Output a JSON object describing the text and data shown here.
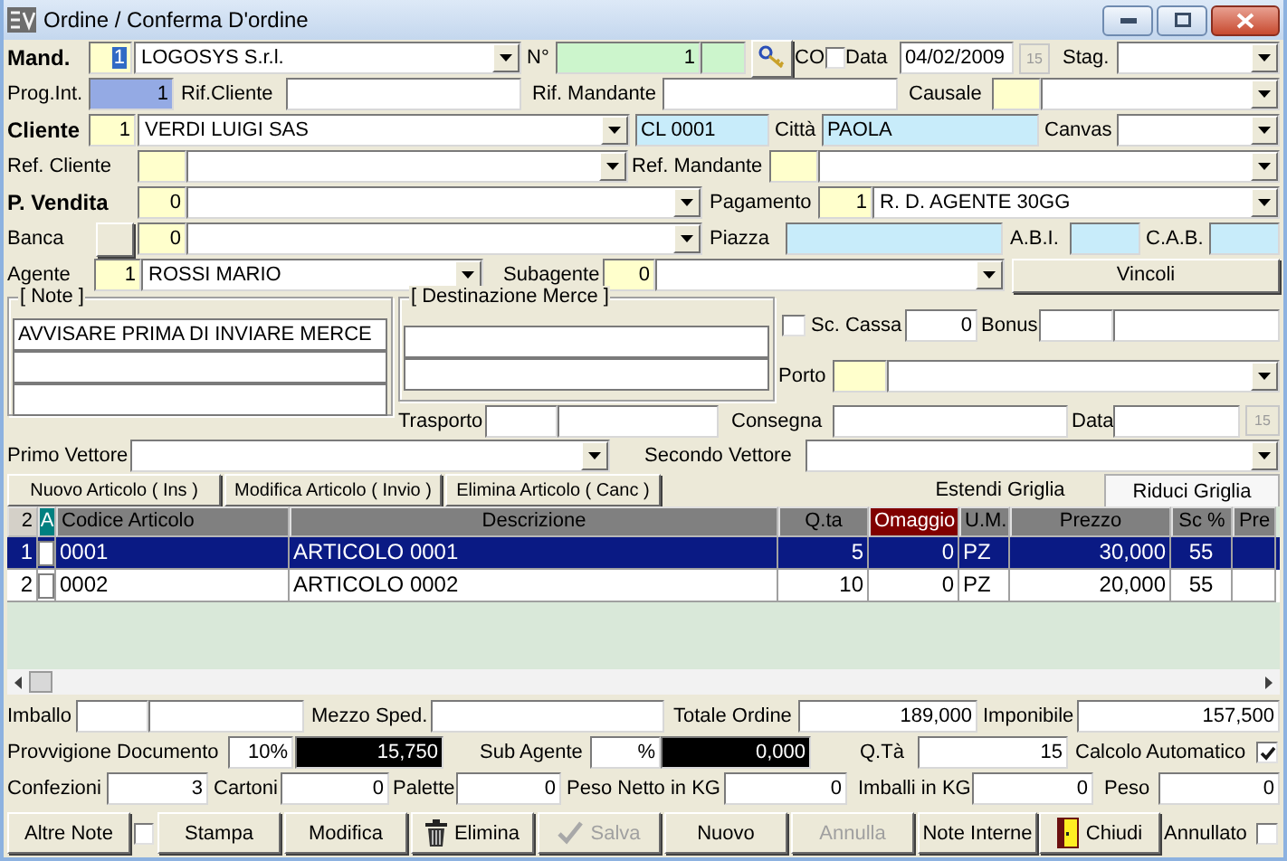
{
  "window": {
    "title": "Ordine / Conferma D'ordine"
  },
  "header_rows": [
    {
      "items": [
        {
          "kind": "heading",
          "text": "Mand."
        },
        {
          "kind": "number_selected",
          "value": "1",
          "color": "#ffffcc"
        },
        {
          "kind": "combo",
          "value": "LOGOSYS S.r.l."
        },
        {
          "kind": "label",
          "text": "N°"
        },
        {
          "kind": "number",
          "value": "1",
          "color": "#ccf5cc"
        },
        {
          "kind": "field",
          "color": "#ccf5cc"
        },
        {
          "kind": "icon_button"
        },
        {
          "kind": "label",
          "text": "CO"
        },
        {
          "kind": "check",
          "checked": false
        },
        {
          "kind": "label",
          "text": "Data"
        },
        {
          "kind": "field",
          "value": "04/02/2009"
        },
        {
          "kind": "calendar",
          "text": "15"
        },
        {
          "kind": "label",
          "text": "Stag."
        },
        {
          "kind": "combo"
        }
      ]
    },
    {
      "items": [
        {
          "kind": "label",
          "text": "Prog.Int."
        },
        {
          "kind": "number",
          "value": "1",
          "color": "#94aae4"
        },
        {
          "kind": "label",
          "text": "Rif.Cliente"
        },
        {
          "kind": "field"
        },
        {
          "kind": "label",
          "text": "Rif. Mandante"
        },
        {
          "kind": "field"
        },
        {
          "kind": "label",
          "text": "Causale"
        },
        {
          "kind": "field",
          "color": "#ffffcc"
        },
        {
          "kind": "combo"
        }
      ]
    },
    {
      "items": [
        {
          "kind": "heading",
          "text": "Cliente"
        },
        {
          "kind": "number",
          "value": "1",
          "color": "#ffffcc"
        },
        {
          "kind": "combo",
          "value": "VERDI LUIGI SAS"
        },
        {
          "kind": "field",
          "value": "CL 0001",
          "color": "#c8ecfa"
        },
        {
          "kind": "label",
          "text": "Città"
        },
        {
          "kind": "field",
          "value": "PAOLA",
          "color": "#c8ecfa"
        },
        {
          "kind": "label",
          "text": "Canvas"
        },
        {
          "kind": "combo"
        }
      ]
    },
    {
      "items": [
        {
          "kind": "label",
          "text": "Ref. Cliente"
        },
        {
          "kind": "field",
          "color": "#ffffcc"
        },
        {
          "kind": "combo"
        },
        {
          "kind": "label",
          "text": "Ref. Mandante"
        },
        {
          "kind": "field",
          "color": "#ffffcc"
        },
        {
          "kind": "combo"
        }
      ]
    },
    {
      "items": [
        {
          "kind": "heading",
          "text": "P. Vendita"
        },
        {
          "kind": "number",
          "value": "0",
          "color": "#ffffcc"
        },
        {
          "kind": "combo"
        },
        {
          "kind": "label",
          "text": "Pagamento"
        },
        {
          "kind": "number",
          "value": "1",
          "color": "#ffffcc"
        },
        {
          "kind": "combo",
          "value": "R. D. AGENTE 30GG"
        }
      ]
    },
    {
      "items": [
        {
          "kind": "label",
          "text": "Banca"
        },
        {
          "kind": "button"
        },
        {
          "kind": "number",
          "value": "0",
          "color": "#ffffcc"
        },
        {
          "kind": "combo"
        },
        {
          "kind": "label",
          "text": "Piazza"
        },
        {
          "kind": "field",
          "color": "#c8ecfa"
        },
        {
          "kind": "label",
          "text": "A.B.I."
        },
        {
          "kind": "field",
          "color": "#c8ecfa"
        },
        {
          "kind": "label",
          "text": "C.A.B."
        },
        {
          "kind": "field",
          "color": "#c8ecfa"
        }
      ]
    },
    {
      "items": [
        {
          "kind": "label",
          "text": "Agente"
        },
        {
          "kind": "number",
          "value": "1",
          "color": "#ffffcc"
        },
        {
          "kind": "combo",
          "value": "ROSSI MARIO"
        },
        {
          "kind": "label",
          "text": "Subagente"
        },
        {
          "kind": "number",
          "value": "0",
          "color": "#ffffcc"
        },
        {
          "kind": "combo"
        },
        {
          "kind": "button",
          "label": "Vincoli"
        }
      ]
    }
  ],
  "note": {
    "title": "[ Note ]",
    "lines": [
      "AVVISARE PRIMA DI INVIARE MERCE"
    ]
  },
  "destinazione_merce": {
    "title": "[ Destinazione Merce ]"
  },
  "side_rows": [
    {
      "items": [
        {
          "kind": "check",
          "checked": false
        },
        {
          "kind": "label",
          "text": "Sc. Cassa"
        },
        {
          "kind": "number",
          "value": "0"
        },
        {
          "kind": "label",
          "text": "Bonus"
        },
        {
          "kind": "field"
        },
        {
          "kind": "field"
        }
      ]
    },
    {
      "items": [
        {
          "kind": "label",
          "text": "Porto"
        },
        {
          "kind": "field",
          "color": "#ffffcc"
        },
        {
          "kind": "combo"
        }
      ]
    }
  ],
  "trasporto_row": {
    "items": [
      {
        "kind": "label",
        "text": "Trasporto"
      },
      {
        "kind": "field"
      },
      {
        "kind": "field"
      },
      {
        "kind": "label",
        "text": "Consegna"
      },
      {
        "kind": "field"
      },
      {
        "kind": "label",
        "text": "Data"
      },
      {
        "kind": "field"
      },
      {
        "kind": "calendar",
        "text": "15"
      }
    ]
  },
  "vettore_row": {
    "items": [
      {
        "kind": "label",
        "text": "Primo Vettore"
      },
      {
        "kind": "combo"
      },
      {
        "kind": "label",
        "text": "Secondo Vettore"
      },
      {
        "kind": "combo"
      }
    ]
  },
  "grid_toolbar": {
    "buttons": [
      "Nuovo Articolo ( Ins )",
      "Modifica Articolo ( Invio )",
      "Elimina Articolo ( Canc )"
    ],
    "tabs": [
      {
        "label": "Estendi Griglia",
        "selected": false
      },
      {
        "label": "Riduci Griglia",
        "selected": true
      }
    ]
  },
  "table": {
    "columns": [
      {
        "label": "2",
        "color": "#d4d0c8"
      },
      {
        "label": "A",
        "color": "#008080"
      },
      {
        "label": "Codice Articolo",
        "color": "#808080"
      },
      {
        "label": "Descrizione",
        "color": "#808080"
      },
      {
        "label": "Q.ta",
        "color": "#808080"
      },
      {
        "label": "Omaggio",
        "color": "#800000"
      },
      {
        "label": "U.M.",
        "color": "#808080"
      },
      {
        "label": "Prezzo",
        "color": "#808080"
      },
      {
        "label": "Sc %",
        "color": "#808080"
      },
      {
        "label": "Pre",
        "color": "#808080"
      }
    ],
    "rows": [
      {
        "selected": true,
        "checked": false,
        "cells": [
          "1",
          "",
          "0001",
          "ARTICOLO 0001",
          "5",
          "0",
          "PZ",
          "30,000",
          "55",
          ""
        ]
      },
      {
        "selected": false,
        "checked": false,
        "cells": [
          "2",
          "",
          "0002",
          "ARTICOLO 0002",
          "10",
          "0",
          "PZ",
          "20,000",
          "55",
          ""
        ]
      }
    ]
  },
  "footer_rows": [
    {
      "items": [
        {
          "kind": "label",
          "text": "Imballo"
        },
        {
          "kind": "field"
        },
        {
          "kind": "field"
        },
        {
          "kind": "label",
          "text": "Mezzo Sped."
        },
        {
          "kind": "field"
        },
        {
          "kind": "label",
          "text": "Totale Ordine"
        },
        {
          "kind": "number",
          "value": "189,000"
        },
        {
          "kind": "label",
          "text": "Imponibile"
        },
        {
          "kind": "number",
          "value": "157,500"
        }
      ]
    },
    {
      "items": [
        {
          "kind": "label",
          "text": "Provvigione Documento"
        },
        {
          "kind": "number",
          "value": "10%"
        },
        {
          "kind": "number",
          "value": "15,750",
          "color": "#000000"
        },
        {
          "kind": "label",
          "text": "Sub Agente"
        },
        {
          "kind": "number",
          "value": "%"
        },
        {
          "kind": "number",
          "value": "0,000",
          "color": "#000000"
        },
        {
          "kind": "label",
          "text": "Q.Tà"
        },
        {
          "kind": "number",
          "value": "15"
        },
        {
          "kind": "label",
          "text": "Calcolo Automatico"
        },
        {
          "kind": "check",
          "checked": true
        }
      ]
    },
    {
      "items": [
        {
          "kind": "label",
          "text": "Confezioni"
        },
        {
          "kind": "number",
          "value": "3"
        },
        {
          "kind": "label",
          "text": "Cartoni"
        },
        {
          "kind": "number",
          "value": "0"
        },
        {
          "kind": "label",
          "text": "Palette"
        },
        {
          "kind": "number",
          "value": "0"
        },
        {
          "kind": "label",
          "text": "Peso Netto in KG"
        },
        {
          "kind": "number",
          "value": "0"
        },
        {
          "kind": "label",
          "text": "Imballi in KG"
        },
        {
          "kind": "number",
          "value": "0"
        },
        {
          "kind": "label",
          "text": "Peso"
        },
        {
          "kind": "number",
          "value": "0"
        }
      ]
    }
  ],
  "button_bar": {
    "items": [
      {
        "kind": "button",
        "label": "Altre Note",
        "disabled": false
      },
      {
        "kind": "check",
        "checked": false
      },
      {
        "kind": "button",
        "label": "Stampa",
        "disabled": false
      },
      {
        "kind": "button",
        "label": "Modifica",
        "disabled": false
      },
      {
        "kind": "button",
        "label": "Elimina",
        "disabled": false
      },
      {
        "kind": "button",
        "label": "Salva",
        "disabled": true
      },
      {
        "kind": "button",
        "label": "Nuovo",
        "disabled": false
      },
      {
        "kind": "button",
        "label": "Annulla",
        "disabled": true
      },
      {
        "kind": "button",
        "label": "Note Interne",
        "disabled": false
      },
      {
        "kind": "button",
        "label": "Chiudi",
        "disabled": false
      },
      {
        "kind": "label",
        "text": "Annullato"
      },
      {
        "kind": "check",
        "checked": false
      }
    ]
  }
}
